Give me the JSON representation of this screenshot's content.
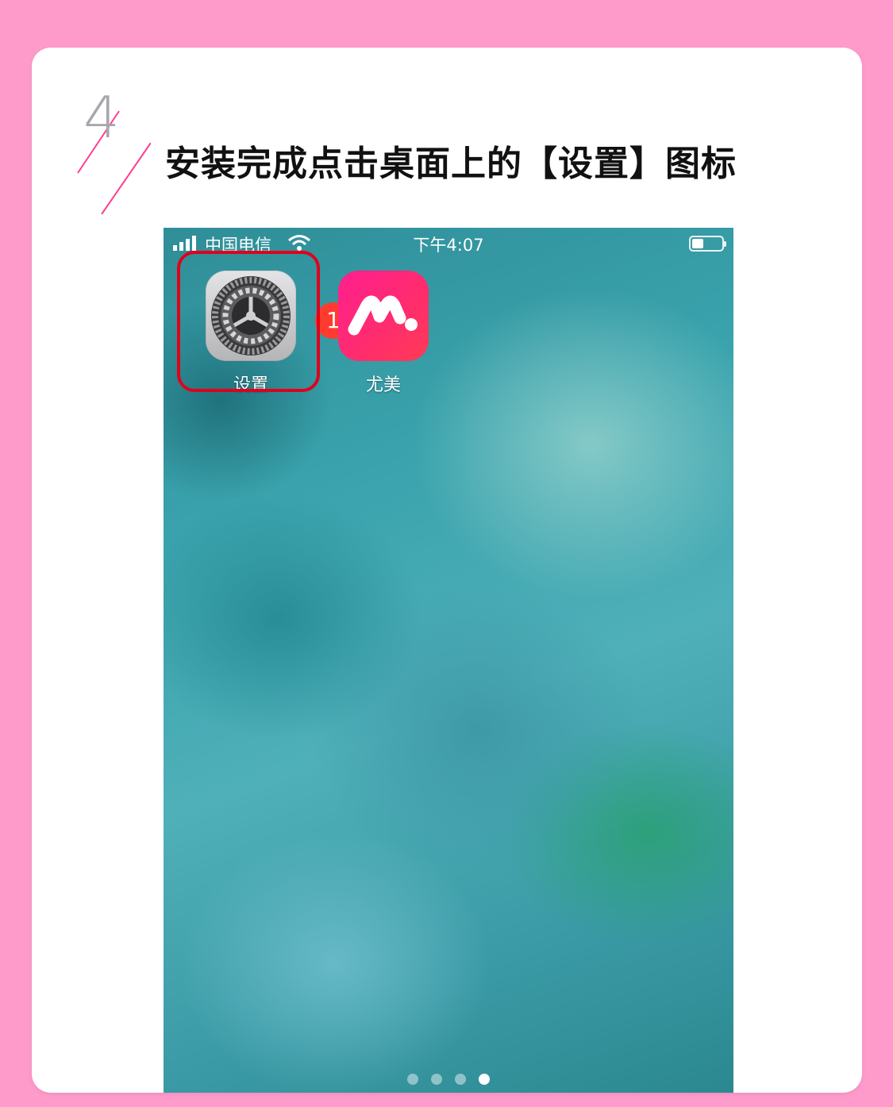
{
  "step": {
    "number": "4",
    "title": "安装完成点击桌面上的【设置】图标"
  },
  "status_bar": {
    "carrier": "中国电信",
    "time": "下午4:07",
    "battery_level": 0.45
  },
  "apps": [
    {
      "label": "设置",
      "icon": "settings-gear-icon",
      "badge": "1"
    },
    {
      "label": "尤美",
      "icon": "youmei-m-logo-icon"
    }
  ],
  "page_indicator": {
    "total": 4,
    "current": 4
  },
  "colors": {
    "page_background": "#ff9bcb",
    "highlight_border": "#e0001b",
    "badge": "#ff3b30",
    "deco_line": "#ff3c8e"
  }
}
